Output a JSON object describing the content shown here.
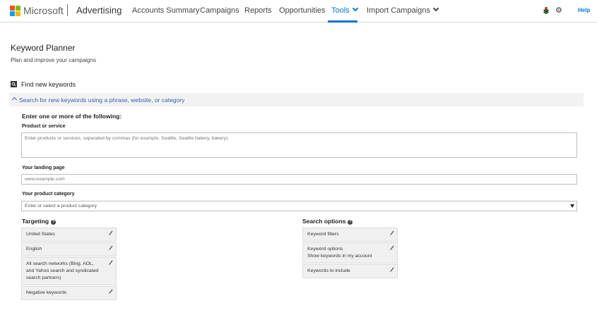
{
  "header": {
    "brand": "Microsoft",
    "product": "Advertising",
    "nav": [
      {
        "label": "Accounts Summary"
      },
      {
        "label": "Campaigns"
      },
      {
        "label": "Reports"
      },
      {
        "label": "Opportunities"
      },
      {
        "label": "Tools",
        "active": true
      },
      {
        "label": "Import Campaigns"
      }
    ],
    "help_label": "Help",
    "icons": [
      "microsoft-logo-icon",
      "bug-icon",
      "gear-icon",
      "chevron-down-icon"
    ],
    "colors": {
      "accent": "#0078d4",
      "link": "#3a5fa6"
    }
  },
  "page": {
    "title": "Keyword Planner",
    "subtitle": "Plan and improve your campaigns"
  },
  "find": {
    "label": "Find new keywords",
    "accordion_label": "Search for new keywords using a phrase, website, or category"
  },
  "form": {
    "intro": "Enter one or more of the following:",
    "product": {
      "label": "Product or service",
      "placeholder": "Enter products or services, separated by commas (for example, Seattle, Seattle bakery, bakery)."
    },
    "landing": {
      "label": "Your landing page",
      "placeholder": "www.example.com"
    },
    "category": {
      "label": "Your product category",
      "placeholder": "Enter or select a product category"
    }
  },
  "targeting": {
    "title": "Targeting",
    "items": [
      {
        "lines": [
          "United States"
        ]
      },
      {
        "lines": [
          "English"
        ]
      },
      {
        "lines": [
          "All search networks (Bing, AOL,",
          "and Yahoo search and syndicated",
          "search partners)"
        ]
      },
      {
        "lines": [
          "Negative keywords"
        ]
      }
    ]
  },
  "search_options": {
    "title": "Search options",
    "items": [
      {
        "lines": [
          "Keyword filters"
        ]
      },
      {
        "lines": [
          "Keyword options",
          "Show keywords in my account"
        ]
      },
      {
        "lines": [
          "Keywords to include"
        ]
      }
    ]
  }
}
